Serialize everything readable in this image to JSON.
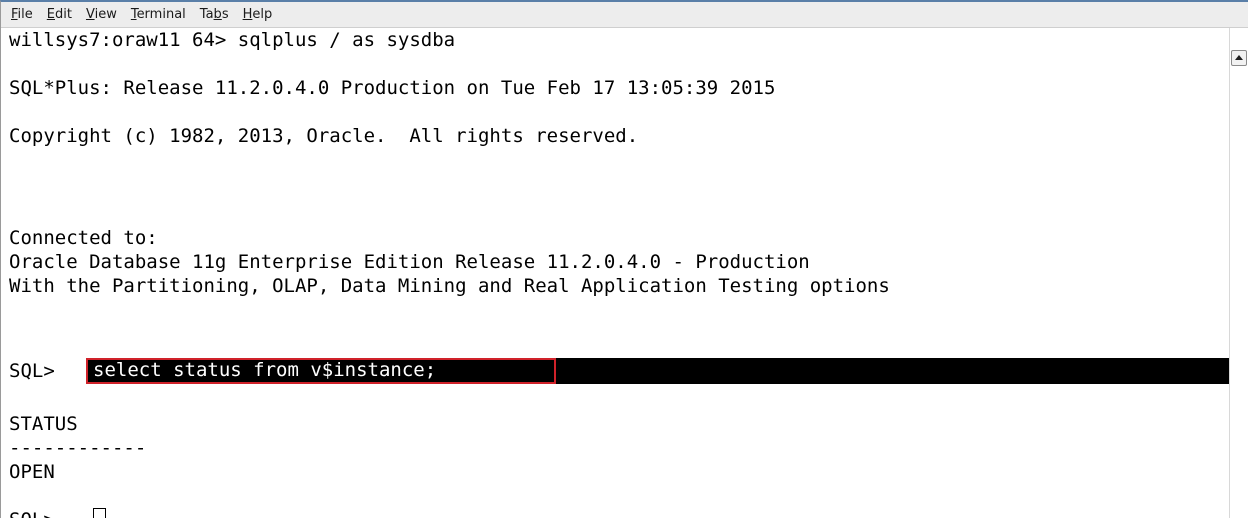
{
  "menubar": {
    "items": [
      {
        "mnemonic": "F",
        "rest": "ile"
      },
      {
        "mnemonic": "E",
        "rest": "dit"
      },
      {
        "mnemonic": "V",
        "rest": "iew"
      },
      {
        "mnemonic": "T",
        "rest": "erminal"
      },
      {
        "pre": "Ta",
        "mnemonic": "b",
        "rest": "s"
      },
      {
        "mnemonic": "H",
        "rest": "elp"
      }
    ]
  },
  "terminal": {
    "lines": [
      "willsys7:oraw11 64> sqlplus / as sysdba",
      "",
      "SQL*Plus: Release 11.2.0.4.0 Production on Tue Feb 17 13:05:39 2015",
      "",
      "Copyright (c) 1982, 2013, Oracle.  All rights reserved.",
      "",
      "",
      "Connected to:",
      "Oracle Database 11g Enterprise Edition Release 11.2.0.4.0 - Production",
      "With the Partitioning, OLAP, Data Mining and Real Application Testing options",
      "",
      "SQL> ",
      "",
      "STATUS",
      "------------",
      "OPEN",
      "",
      "SQL> "
    ],
    "highlighted_command": "select status from v$instance;",
    "colors": {
      "background": "#ffffff",
      "foreground": "#000000",
      "selection": "#000000",
      "annotation_box": "#d0222a"
    }
  }
}
